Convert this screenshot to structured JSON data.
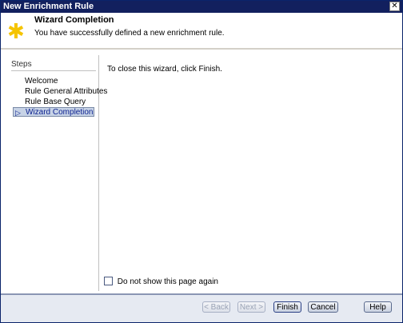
{
  "window": {
    "title": "New Enrichment Rule",
    "close_glyph": "✕"
  },
  "header": {
    "icon": "wizard-star-icon",
    "title": "Wizard Completion",
    "subtitle": "You have successfully defined a new enrichment rule."
  },
  "sidebar": {
    "label": "Steps",
    "items": [
      {
        "label": "Welcome",
        "active": false
      },
      {
        "label": "Rule General Attributes",
        "active": false
      },
      {
        "label": "Rule Base Query",
        "active": false
      },
      {
        "label": "Wizard Completion",
        "active": true
      }
    ]
  },
  "main": {
    "message": "To close this wizard, click Finish.",
    "checkbox_label": "Do not show this page again",
    "checkbox_checked": false
  },
  "footer": {
    "back_label": "< Back",
    "next_label": "Next >",
    "finish_label": "Finish",
    "cancel_label": "Cancel",
    "help_label": "Help"
  },
  "colors": {
    "title_bar": "#12205e",
    "accent_star": "#f5c400",
    "active_step_bg": "#c7d3e6"
  }
}
